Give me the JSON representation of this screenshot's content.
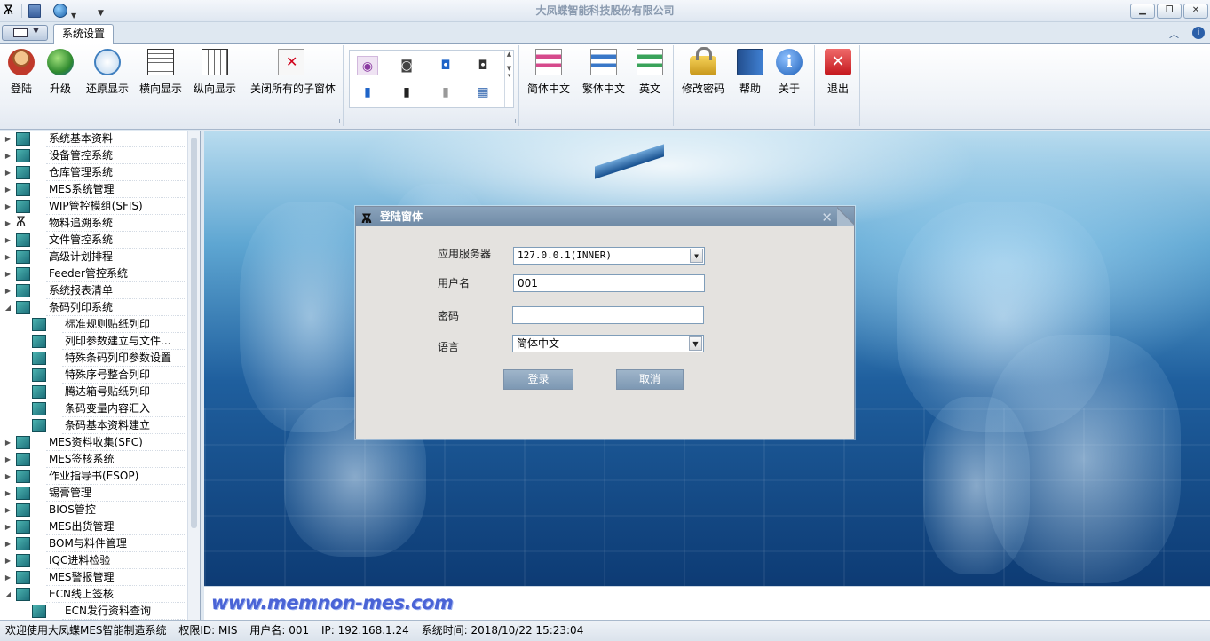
{
  "app_title": "大凤蝶智能科技股份有限公司",
  "tab_label": "系统设置",
  "ribbon": {
    "login": "登陆",
    "upgrade": "升级",
    "restore": "还原显示",
    "horizontal": "横向显示",
    "vertical": "纵向显示",
    "close_all": "关闭所有的子窗体",
    "simplified": "简体中文",
    "traditional": "繁体中文",
    "english": "英文",
    "change_password": "修改密码",
    "help": "帮助",
    "about": "关于",
    "exit": "退出"
  },
  "tree": [
    {
      "label": "系统基本资料",
      "level": 0,
      "expanded": false
    },
    {
      "label": "设备管控系统",
      "level": 0,
      "expanded": false
    },
    {
      "label": "仓库管理系统",
      "level": 0,
      "expanded": false
    },
    {
      "label": "MES系统管理",
      "level": 0,
      "expanded": false
    },
    {
      "label": "WIP管控模组(SFIS)",
      "level": 0,
      "expanded": false
    },
    {
      "label": "物料追溯系统",
      "level": 0,
      "expanded": false,
      "icon": "butterfly"
    },
    {
      "label": "文件管控系统",
      "level": 0,
      "expanded": false
    },
    {
      "label": "高级计划排程",
      "level": 0,
      "expanded": false
    },
    {
      "label": "Feeder管控系统",
      "level": 0,
      "expanded": false
    },
    {
      "label": "系统报表清单",
      "level": 0,
      "expanded": false
    },
    {
      "label": "条码列印系统",
      "level": 0,
      "expanded": true
    },
    {
      "label": "标准规则贴纸列印",
      "level": 1
    },
    {
      "label": "列印参数建立与文件...",
      "level": 1
    },
    {
      "label": "特殊条码列印参数设置",
      "level": 1
    },
    {
      "label": "特殊序号整合列印",
      "level": 1
    },
    {
      "label": "腾达箱号贴纸列印",
      "level": 1
    },
    {
      "label": "条码变量内容汇入",
      "level": 1
    },
    {
      "label": "条码基本资料建立",
      "level": 1
    },
    {
      "label": "MES资料收集(SFC)",
      "level": 0,
      "expanded": false
    },
    {
      "label": "MES签核系统",
      "level": 0,
      "expanded": false
    },
    {
      "label": "作业指导书(ESOP)",
      "level": 0,
      "expanded": false
    },
    {
      "label": "锡膏管理",
      "level": 0,
      "expanded": false
    },
    {
      "label": "BIOS管控",
      "level": 0,
      "expanded": false
    },
    {
      "label": "MES出货管理",
      "level": 0,
      "expanded": false
    },
    {
      "label": "BOM与料件管理",
      "level": 0,
      "expanded": false
    },
    {
      "label": "IQC进料检验",
      "level": 0,
      "expanded": false
    },
    {
      "label": "MES警报管理",
      "level": 0,
      "expanded": false
    },
    {
      "label": "ECN线上签核",
      "level": 0,
      "expanded": true
    },
    {
      "label": "ECN发行资料查询",
      "level": 1
    }
  ],
  "brand_url": "www.memnon-mes.com",
  "dialog": {
    "title": "登陆窗体",
    "server_label": "应用服务器",
    "server_value": "127.0.0.1(INNER)",
    "user_label": "用户名",
    "user_value": "001",
    "password_label": "密码",
    "password_value": "",
    "language_label": "语言",
    "language_value": "简体中文",
    "login_button": "登录",
    "cancel_button": "取消"
  },
  "status": {
    "welcome": "欢迎使用大凤蝶MES智能制造系统",
    "permission": "权限ID: MIS",
    "user": "用户名: 001",
    "ip": "IP: 192.168.1.24",
    "time": "系统时间: 2018/10/22 15:23:04"
  },
  "colors": {
    "accent": "#1f5f9e",
    "dialog_title": "#7f97b0",
    "brand_url": "#4a64d6"
  }
}
